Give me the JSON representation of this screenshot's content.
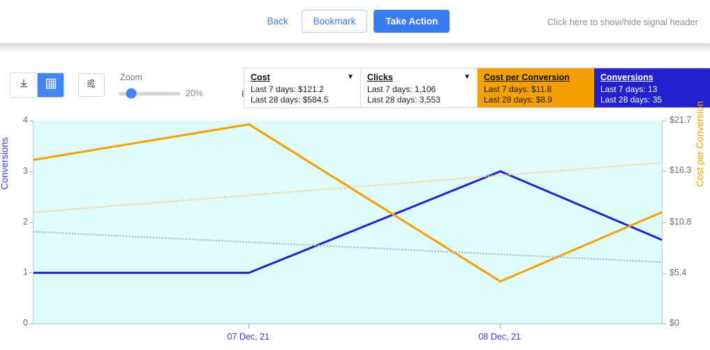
{
  "header": {
    "back_label": "Back",
    "bookmark_label": "Bookmark",
    "take_action_label": "Take Action",
    "signal_toggle_label": "Click here to show/hide signal header"
  },
  "toolbar": {
    "download_icon": "download-icon",
    "table_icon": "table-grid-icon",
    "settings_icon": "sliders-settings-icon",
    "zoom_label": "Zoom",
    "zoom_percent": "20%",
    "zoom_value": 20,
    "reset_icon": "refresh-ccw-icon",
    "reset_label": "Reset"
  },
  "cards": [
    {
      "title": "Cost",
      "line1": "Last 7 days: $121.2",
      "line2": "Last 28 days: $584.5",
      "caret": "▼",
      "style": "plain"
    },
    {
      "title": "Clicks",
      "line1": "Last 7 days: 1,106",
      "line2": "Last 28 days: 3,553",
      "caret": "▼",
      "style": "plain"
    },
    {
      "title": "Cost per Conversion",
      "line1": "Last 7 days: $11.8",
      "line2": "Last 28 days: $8.9",
      "caret": "",
      "style": "orange"
    },
    {
      "title": "Conversions",
      "line1": "Last 7 days: 13",
      "line2": "Last 28 days: 35",
      "caret": "",
      "style": "blue"
    }
  ],
  "colors": {
    "accent_blue": "#4285f4",
    "series_blue": "#2222cc",
    "series_orange": "#f5a000",
    "trend_blue": "#9fb4df",
    "trend_orange": "#f7c98a",
    "plot_background": "#e0fbfb",
    "link_blue": "#3a7bf0"
  },
  "chart_data": {
    "type": "line",
    "title": "",
    "xlabel": "",
    "grid": false,
    "legend": "none",
    "x": [
      "07 Dec, 21",
      "08 Dec, 21"
    ],
    "x_tick_positions_pct": [
      34.3,
      74.3
    ],
    "left_axis": {
      "label": "Conversions",
      "ticks": [
        0,
        1,
        2,
        3,
        4
      ],
      "tick_labels": [
        "0",
        "1",
        "2",
        "3",
        "4"
      ],
      "range": [
        0,
        4
      ],
      "color": "#3a3ae0"
    },
    "right_axis": {
      "label": "Cost per Conversion",
      "ticks": [
        0,
        5.4,
        10.8,
        16.3,
        21.7
      ],
      "tick_labels": [
        "$0",
        "$5.4",
        "$10.8",
        "$16.3",
        "$21.7"
      ],
      "range": [
        0,
        21.7
      ],
      "color": "#f5a000"
    },
    "series": [
      {
        "name": "Conversions",
        "axis": "left",
        "color": "#2222cc",
        "style": "solid",
        "points_pct_x": [
          0,
          34.3,
          74.3,
          100
        ],
        "values": [
          1,
          1,
          3,
          1.65
        ]
      },
      {
        "name": "Cost per Conversion",
        "axis": "right",
        "color": "#f5a000",
        "style": "solid",
        "points_pct_x": [
          0,
          34.3,
          74.3,
          100
        ],
        "values": [
          17.5,
          21.3,
          4.5,
          11.9
        ]
      },
      {
        "name": "Conversions trend",
        "axis": "left",
        "color": "#9fb4df",
        "style": "dotted",
        "points_pct_x": [
          0,
          100
        ],
        "values": [
          1.81,
          1.21
        ]
      },
      {
        "name": "Cost per Conversion trend",
        "axis": "right",
        "color": "#f7c98a",
        "style": "dotted",
        "points_pct_x": [
          0,
          100
        ],
        "values": [
          11.9,
          17.2
        ]
      }
    ]
  }
}
